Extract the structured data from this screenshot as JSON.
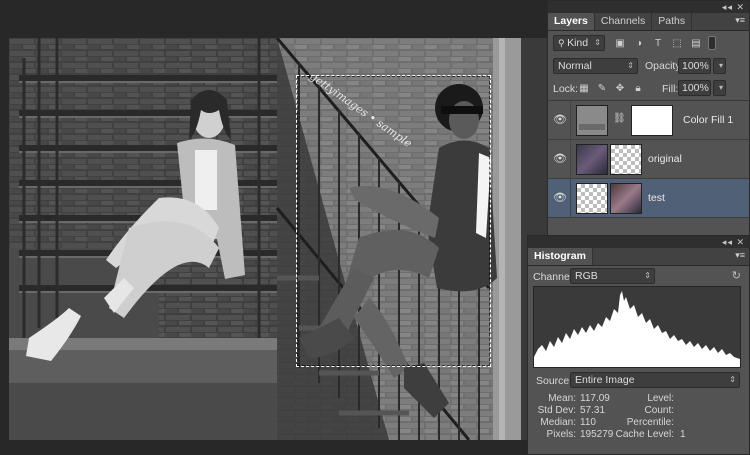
{
  "layers_panel": {
    "tabs": [
      {
        "label": "Layers",
        "active": true
      },
      {
        "label": "Channels",
        "active": false
      },
      {
        "label": "Paths",
        "active": false
      }
    ],
    "filter_kind": "Kind",
    "blend_mode": "Normal",
    "opacity_label": "Opacity:",
    "opacity_value": "100%",
    "lock_label": "Lock:",
    "fill_label": "Fill:",
    "fill_value": "100%",
    "layers": [
      {
        "name": "Color Fill 1",
        "visible": true,
        "selected": false
      },
      {
        "name": "original",
        "visible": true,
        "selected": false
      },
      {
        "name": "test",
        "visible": true,
        "selected": true
      }
    ]
  },
  "histogram_panel": {
    "tab": "Histogram",
    "channel_label": "Channel:",
    "channel_value": "RGB",
    "source_label": "Source:",
    "source_value": "Entire Image",
    "stats_left": [
      {
        "label": "Mean:",
        "value": "117.09"
      },
      {
        "label": "Std Dev:",
        "value": "57.31"
      },
      {
        "label": "Median:",
        "value": "110"
      },
      {
        "label": "Pixels:",
        "value": "195279"
      }
    ],
    "stats_right": [
      {
        "label": "Level:",
        "value": ""
      },
      {
        "label": "Count:",
        "value": ""
      },
      {
        "label": "Percentile:",
        "value": ""
      },
      {
        "label": "Cache Level:",
        "value": "1"
      }
    ]
  },
  "canvas": {
    "watermark": "Photoshop sample"
  },
  "colors": {
    "panel_bg": "#535353",
    "selected_layer": "#506077",
    "workspace_bg": "#282828"
  }
}
